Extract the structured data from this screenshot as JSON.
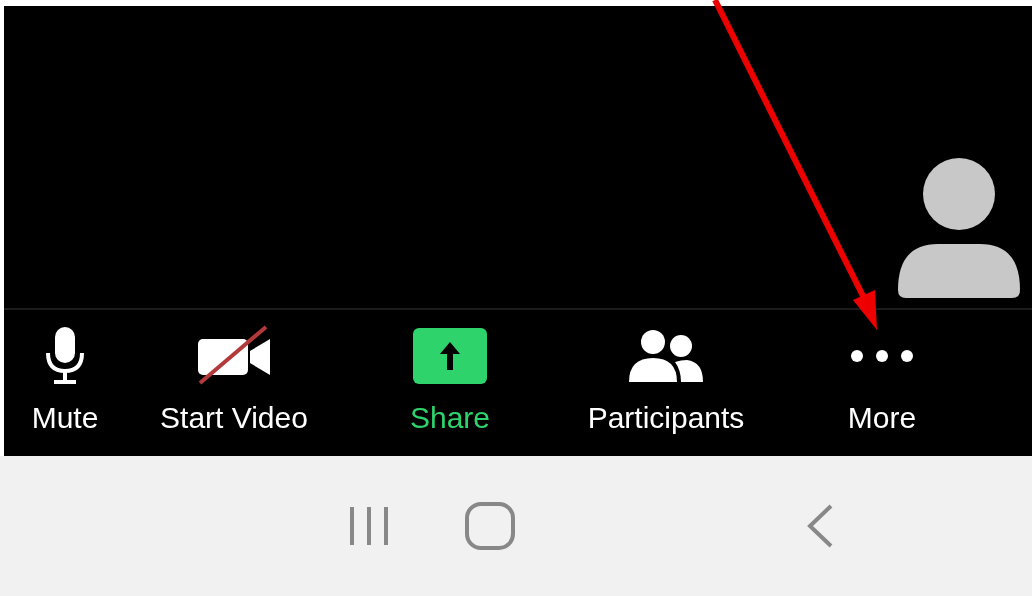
{
  "toolbar": {
    "items": [
      {
        "kind": "mic",
        "label": "Mute",
        "highlighted": false
      },
      {
        "kind": "video",
        "label": "Start Video",
        "highlighted": false,
        "off": true
      },
      {
        "kind": "share",
        "label": "Share",
        "highlighted": true
      },
      {
        "kind": "participants",
        "label": "Participants",
        "highlighted": false
      },
      {
        "kind": "more",
        "label": "More",
        "highlighted": false
      }
    ]
  },
  "nav_bar": {
    "items": [
      {
        "kind": "recents"
      },
      {
        "kind": "home"
      },
      {
        "kind": "back"
      }
    ]
  }
}
